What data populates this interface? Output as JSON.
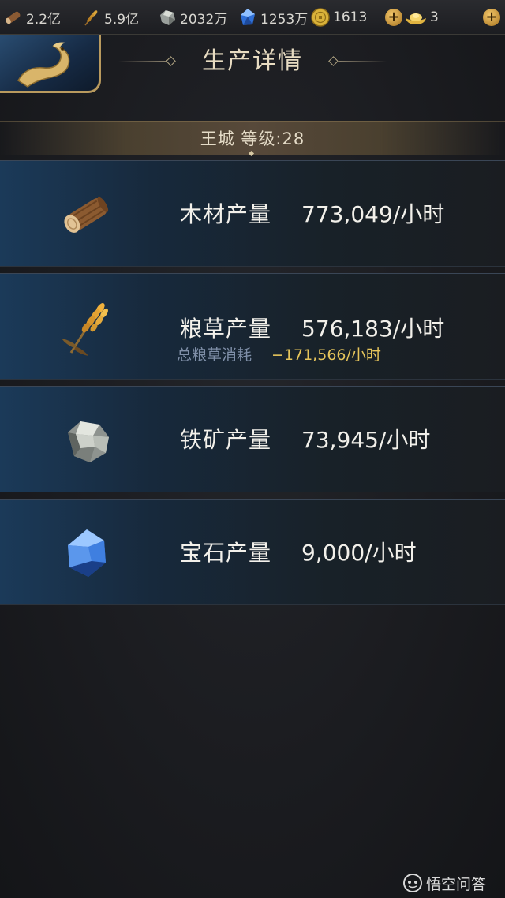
{
  "resources": {
    "wood": {
      "icon": "wood-log-icon",
      "value": "2.2亿"
    },
    "food": {
      "icon": "wheat-icon",
      "value": "5.9亿"
    },
    "iron": {
      "icon": "iron-ore-icon",
      "value": "2032万"
    },
    "gem": {
      "icon": "gem-icon",
      "value": "1253万"
    },
    "coin": {
      "icon": "coin-icon",
      "value": "1613"
    },
    "gold": {
      "icon": "gold-ingot-icon",
      "value": "3"
    }
  },
  "header": {
    "title": "生产详情",
    "back_icon": "dragon-emblem-icon"
  },
  "city": {
    "label": "王城  等级:28"
  },
  "production": [
    {
      "icon": "wood-log-icon",
      "label": "木材产量",
      "value": "773,049/小时"
    },
    {
      "icon": "wheat-icon",
      "label": "粮草产量",
      "value": "576,183/小时",
      "sub_label": "总粮草消耗",
      "sub_value": "−171,566/小时"
    },
    {
      "icon": "iron-ore-icon",
      "label": "铁矿产量",
      "value": "73,945/小时"
    },
    {
      "icon": "gem-icon",
      "label": "宝石产量",
      "value": "9,000/小时"
    }
  ],
  "watermark": {
    "text": "悟空问答",
    "icon": "wukong-logo-icon"
  },
  "colors": {
    "gold_accent": "#b99a5e",
    "consumption_text": "#e6c55b",
    "sub_label_text": "#7f8fa8"
  }
}
